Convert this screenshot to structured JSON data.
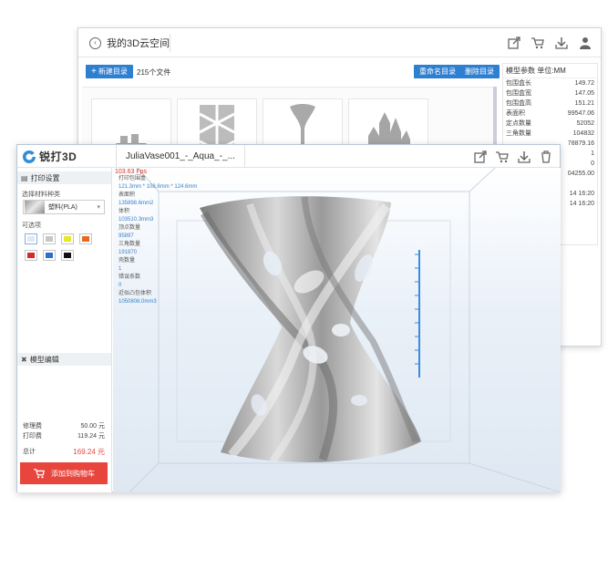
{
  "back_window": {
    "title": "我的3D云空间",
    "toolbar": {
      "new_folder": "新建目录",
      "file_count": "215个文件",
      "rename": "重命名目录",
      "delete": "删除目录"
    },
    "properties": {
      "header": "模型参数 单位:MM",
      "rows": [
        {
          "label": "包围盒长",
          "value": "149.72"
        },
        {
          "label": "包围盒宽",
          "value": "147.05"
        },
        {
          "label": "包围盒高",
          "value": "151.21"
        },
        {
          "label": "表面积",
          "value": "99547.06"
        },
        {
          "label": "定点数量",
          "value": "52052"
        },
        {
          "label": "三角数量",
          "value": "104832"
        },
        {
          "label": "",
          "value": "78879.16"
        },
        {
          "label": "",
          "value": "1"
        },
        {
          "label": "",
          "value": "0"
        },
        {
          "label": "",
          "value": "04255.00"
        },
        {
          "label": "",
          "value": ""
        },
        {
          "label": "",
          "value": "14 16:20"
        },
        {
          "label": "",
          "value": "14 16:20"
        }
      ]
    }
  },
  "front_window": {
    "logo_text": "锐打3D",
    "file_tab": "JuliaVase001_-_Aqua_-_...",
    "print_settings": "打印设置",
    "material_label": "选择材料种类",
    "material": "塑料(PLA)",
    "color_label": "可选项",
    "colors": [
      "#dfe9f1",
      "#c7c7c7",
      "#e8e82a",
      "#e66a1e",
      "#d42a2a",
      "#2c6fcf",
      "#111111"
    ],
    "model_edit": "模型编辑",
    "prices": {
      "labels": [
        "修理费",
        "打印费",
        "总计"
      ],
      "values": [
        "50.00 元",
        "119.24 元",
        "169.24 元"
      ]
    },
    "cart_button": "添加到购物车",
    "fps": "103.63 Fps",
    "stats": [
      {
        "label": "打印包围盒",
        "value": "121.3mm * 108.8mm * 124.6mm"
      },
      {
        "label": "表面积",
        "value": "135898.6mm2"
      },
      {
        "label": "体积",
        "value": "103510.3mm3"
      },
      {
        "label": "顶点数量",
        "value": "95897"
      },
      {
        "label": "三角数量",
        "value": "191870"
      },
      {
        "label": "壳数量",
        "value": "1"
      },
      {
        "label": "错误系数",
        "value": "0"
      },
      {
        "label": "近似凸包体积",
        "value": "1050808.0mm3"
      }
    ]
  },
  "icons": [
    "back-arrow-icon",
    "share-icon",
    "cart-icon",
    "download-icon",
    "user-icon",
    "trash-icon",
    "printer-icon",
    "wrench-icon"
  ]
}
